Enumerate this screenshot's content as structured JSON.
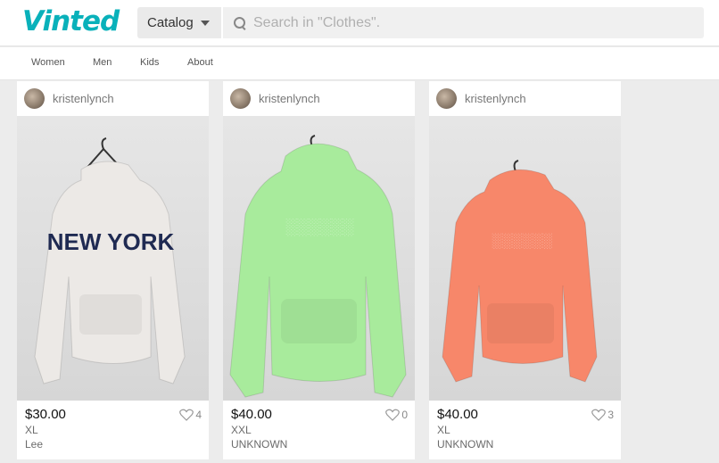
{
  "header": {
    "logo": "Vinted",
    "catalog_label": "Catalog",
    "search_placeholder": "Search in \"Clothes\"."
  },
  "nav": [
    "Women",
    "Men",
    "Kids",
    "About"
  ],
  "items": [
    {
      "user": "kristenlynch",
      "price": "$30.00",
      "size": "XL",
      "brand": "Lee",
      "likes": "4",
      "photo_subject": "white NEW YORK hoodie",
      "color": "#ece9e6",
      "print": "NEW YORK"
    },
    {
      "user": "kristenlynch",
      "price": "$40.00",
      "size": "XXL",
      "brand": "UNKNOWN",
      "likes": "0",
      "photo_subject": "mint green hoodie",
      "color": "#a8eb9c"
    },
    {
      "user": "kristenlynch",
      "price": "$40.00",
      "size": "XL",
      "brand": "UNKNOWN",
      "likes": "3",
      "photo_subject": "coral orange hoodie",
      "color": "#f7876a"
    }
  ],
  "colors": {
    "brand": "#09b1ba"
  }
}
